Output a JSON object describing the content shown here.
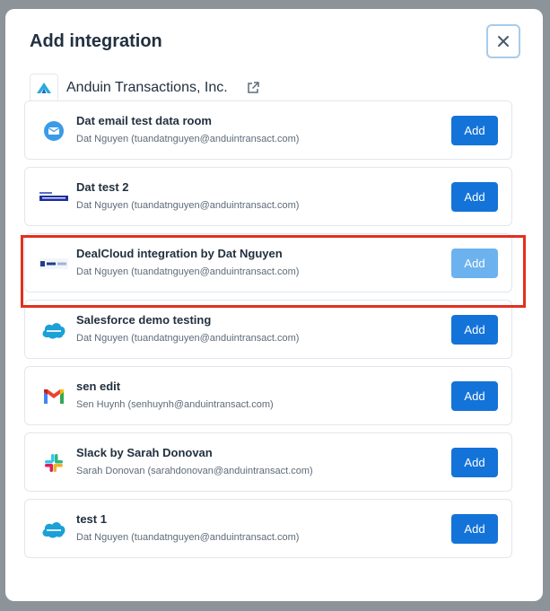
{
  "modal": {
    "title": "Add integration",
    "close_icon": "close-icon"
  },
  "organization": {
    "name": "Anduin Transactions, Inc.",
    "logo_icon": "anduin-logo-icon",
    "link_icon": "external-link-icon"
  },
  "integrations": [
    {
      "name": "Dat email test data room",
      "owner": "Dat Nguyen (tuandatnguyen@anduintransact.com)",
      "icon": "email-icon",
      "add_label": "Add",
      "disabled": false
    },
    {
      "name": "Dat test 2",
      "owner": "Dat Nguyen (tuandatnguyen@anduintransact.com)",
      "icon": "intapp-logo-icon",
      "add_label": "Add",
      "disabled": false
    },
    {
      "name": "DealCloud integration by Dat Nguyen",
      "owner": "Dat Nguyen (tuandatnguyen@anduintransact.com)",
      "icon": "dealcloud-logo-icon",
      "add_label": "Add",
      "disabled": true
    },
    {
      "name": "Salesforce demo testing",
      "owner": "Dat Nguyen (tuandatnguyen@anduintransact.com)",
      "icon": "salesforce-logo-icon",
      "add_label": "Add",
      "disabled": false
    },
    {
      "name": "sen edit",
      "owner": "Sen Huynh (senhuynh@anduintransact.com)",
      "icon": "gmail-logo-icon",
      "add_label": "Add",
      "disabled": false
    },
    {
      "name": "Slack by Sarah Donovan",
      "owner": "Sarah Donovan (sarahdonovan@anduintransact.com)",
      "icon": "slack-logo-icon",
      "add_label": "Add",
      "disabled": false
    },
    {
      "name": "test 1",
      "owner": "Dat Nguyen (tuandatnguyen@anduintransact.com)",
      "icon": "salesforce-logo-icon",
      "add_label": "Add",
      "disabled": false
    }
  ],
  "colors": {
    "primary": "#1473d8",
    "primary_disabled": "#6cb2ef",
    "highlight": "#e2301f"
  }
}
